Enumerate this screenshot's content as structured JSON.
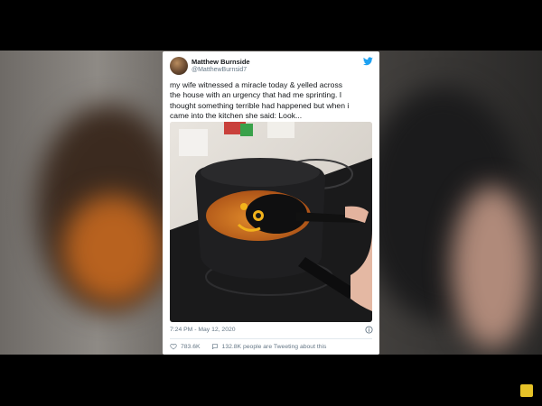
{
  "tweet": {
    "display_name": "Matthew Burnside",
    "handle": "@MatthewBurnsid7",
    "text": "my wife witnessed a miracle today & yelled across\nthe house with an urgency that had me sprinting. I\nthought something terrible had happened but when i\ncame into the kitchen she said: Look...",
    "timestamp": "7:24 PM - May 12, 2020",
    "likes": "783.6K",
    "tweeting_about": "132.8K people are Tweeting about this"
  },
  "icons": {
    "brand": "twitter-bird-icon",
    "info": "info-icon",
    "like": "heart-icon",
    "reply": "speech-bubble-icon",
    "channel": "channel-logo-icon"
  },
  "colors": {
    "twitter_blue": "#1da1f2",
    "meta_gray": "#657786",
    "text_dark": "#14171a"
  }
}
